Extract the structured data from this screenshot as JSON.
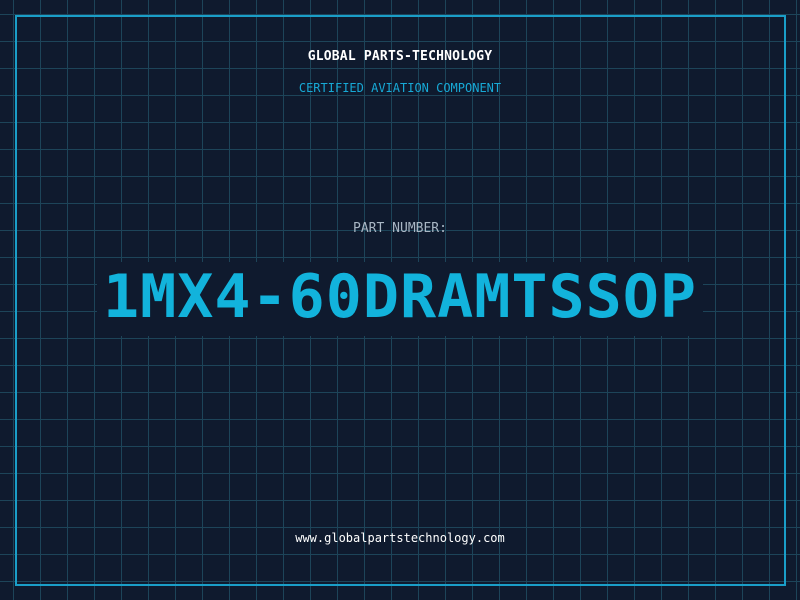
{
  "header": {
    "company_name": "GLOBAL PARTS-TECHNOLOGY",
    "subtitle": "CERTIFIED AVIATION COMPONENT"
  },
  "part": {
    "label": "PART NUMBER:",
    "number": "1MX4-60DRAMTSSOP"
  },
  "footer": {
    "website": "www.globalpartstechnology.com"
  },
  "colors": {
    "background": "#0f1a2e",
    "grid": "#1d4459",
    "frame": "#1a9ec8",
    "accent": "#12b3dc",
    "label": "#a9b6c4",
    "text": "#ffffff"
  }
}
